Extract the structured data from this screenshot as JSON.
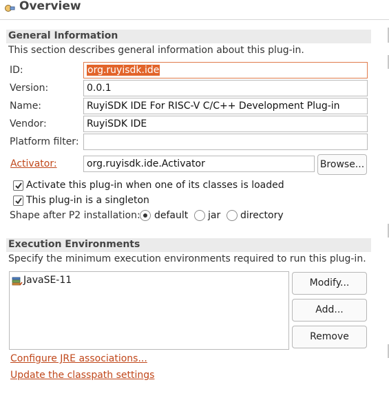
{
  "header": {
    "title": "Overview",
    "icon": "plugin-icon"
  },
  "general": {
    "title": "General Information",
    "description": "This section describes general information about this plug-in.",
    "fields": {
      "id": {
        "label": "ID:",
        "value": "org.ruyisdk.ide"
      },
      "version": {
        "label": "Version:",
        "value": "0.0.1"
      },
      "name": {
        "label": "Name:",
        "value": "RuyiSDK IDE For RISC-V C/C++ Development Plug-in"
      },
      "vendor": {
        "label": "Vendor:",
        "value": "RuyiSDK IDE"
      },
      "platform_filter": {
        "label": "Platform filter:",
        "value": ""
      },
      "activator": {
        "label": "Activator:",
        "value": "org.ruyisdk.ide.Activator"
      }
    },
    "browse_label": "Browse...",
    "checkboxes": [
      {
        "label": "Activate this plug-in when one of its classes is loaded",
        "checked": true
      },
      {
        "label": "This plug-in is a singleton",
        "checked": true
      }
    ],
    "shape": {
      "label": "Shape after P2 installation:",
      "options": [
        "default",
        "jar",
        "directory"
      ],
      "selected": "default"
    }
  },
  "execution": {
    "title": "Execution Environments",
    "description": "Specify the minimum execution environments required to run this plug-in.",
    "items": [
      {
        "label": "JavaSE-11",
        "icon": "java-library-icon"
      }
    ],
    "buttons": {
      "modify": "Modify...",
      "add": "Add...",
      "remove": "Remove"
    },
    "links": {
      "configure_jre": "Configure JRE associations...",
      "update_classpath": "Update the classpath settings"
    }
  },
  "colors": {
    "accent": "#e2642a",
    "link": "#c0471a",
    "section_bar": "#ebebeb"
  }
}
